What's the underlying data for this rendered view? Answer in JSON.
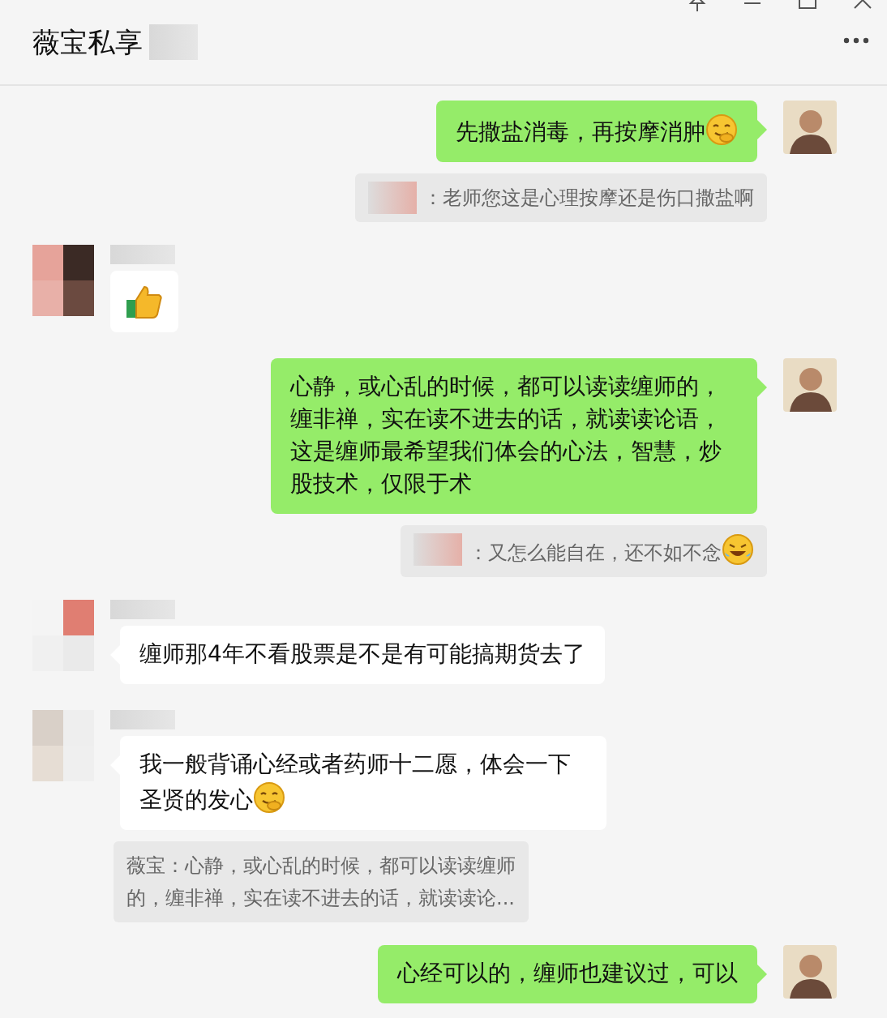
{
  "window": {
    "title": "薇宝私享",
    "title_suffix_blurred": true
  },
  "messages": [
    {
      "kind": "text",
      "outgoing": true,
      "text": "先撒盐消毒，再按摩消肿",
      "emoji": {
        "kind": "smile"
      }
    },
    {
      "kind": "quote",
      "outgoing": true,
      "sender_blurred": true,
      "text": "：老师您这是心理按摩还是伤口撒盐啊"
    },
    {
      "kind": "sticker",
      "sticker": {
        "kind": "thumbs"
      }
    },
    {
      "kind": "text",
      "outgoing": true,
      "text": "心静，或心乱的时候，都可以读读缠师的，缠非禅，实在读不进去的话，就读读论语，这是缠师最希望我们体会的心法，智慧，炒股技术，仅限于术"
    },
    {
      "kind": "quote",
      "outgoing": true,
      "sender_blurred": true,
      "text": "：又怎么能自在，还不如不念",
      "emoji": {
        "kind": "laugh"
      }
    },
    {
      "kind": "text",
      "outgoing": false,
      "text": "缠师那4年不看股票是不是有可能搞期货去了"
    },
    {
      "kind": "text",
      "outgoing": false,
      "text": "我一般背诵心经或者药师十二愿，体会一下圣贤的发心",
      "emoji": {
        "kind": "smile"
      }
    },
    {
      "kind": "quote",
      "outgoing": false,
      "sender_blurred": false,
      "text": "薇宝：心静，或心乱的时候，都可以读读缠师的，缠非禅，实在读不进去的话，就读读论..."
    },
    {
      "kind": "text",
      "outgoing": true,
      "text": "心经可以的，缠师也建议过，可以"
    }
  ]
}
